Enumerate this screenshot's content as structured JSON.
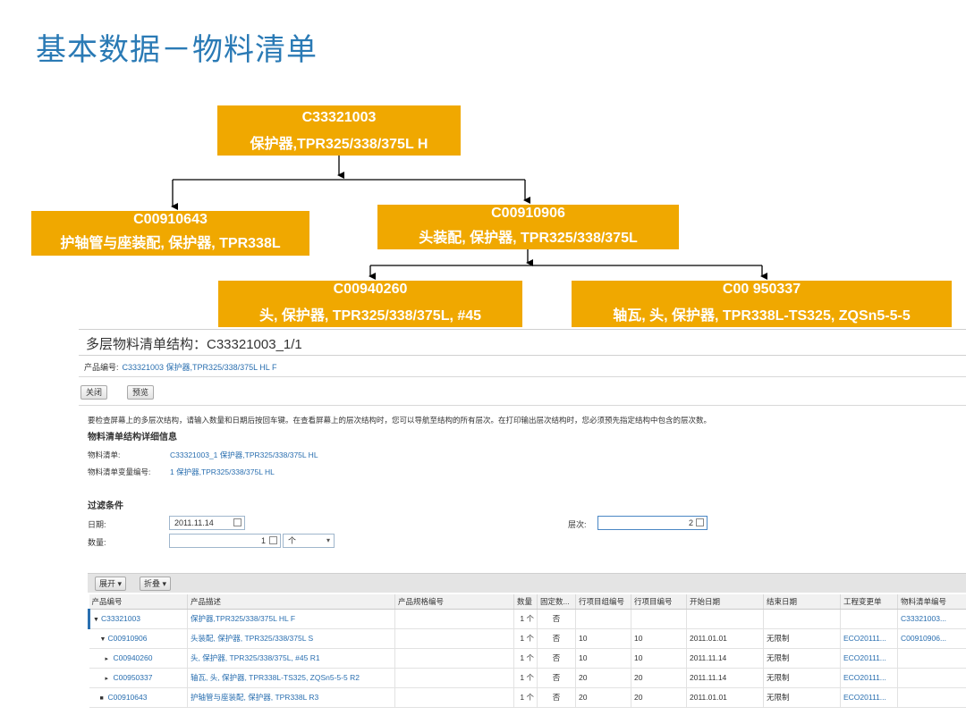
{
  "slide": {
    "title": "基本数据－物料清单"
  },
  "colors": {
    "node_fill": "#f0a800",
    "title_blue": "#2a7ab5",
    "link_blue": "#2a6fb0"
  },
  "tree": {
    "root": {
      "code": "C33321003",
      "desc": "保护器,TPR325/338/375L H"
    },
    "child_a": {
      "code": "C00910643",
      "desc": "护轴管与座装配, 保护器, TPR338L"
    },
    "child_b": {
      "code": "C00910906",
      "desc": "头装配, 保护器, TPR325/338/375L"
    },
    "grand_c": {
      "code": "C00940260",
      "desc": "头, 保护器, TPR325/338/375L, #45"
    },
    "grand_d": {
      "code": "C00 950337",
      "desc": "轴瓦, 头, 保护器, TPR338L-TS325, ZQSn5-5-5"
    }
  },
  "sap": {
    "window_title": "多层物料清单结构：C33321003_1/1",
    "product_label": "产品编号:",
    "product_value": "C33321003 保护器,TPR325/338/375L HL F",
    "close_label": "关闭",
    "preview_label": "预览",
    "instruction": "要检查屏幕上的多层次结构，请输入数量和日期后按回车键。在查看屏幕上的层次结构时，您可以导航至结构的所有层次。在打印输出层次结构时，您必须预先指定结构中包含的层次数。",
    "detail_heading": "物料清单结构详细信息",
    "bom_label": "物料清单:",
    "bom_value": "C33321003_1 保护器,TPR325/338/375L HL",
    "variant_label": "物料清单变量编号:",
    "variant_value": "1 保护器,TPR325/338/375L HL",
    "filter_heading": "过滤条件",
    "date_label": "日期:",
    "date_value": "2011.11.14",
    "qty_label": "数量:",
    "qty_value": "1",
    "unit_value": "个",
    "level_label": "层次:",
    "level_value": "2",
    "expand_label": "展开",
    "collapse_label": "折叠",
    "columns": [
      "产品编号",
      "产品描述",
      "产品规格编号",
      "数量",
      "固定数...",
      "行项目组编号",
      "行项目编号",
      "开始日期",
      "结束日期",
      "工程变更单",
      "物料清单编号"
    ],
    "rows": [
      {
        "tw": "▼",
        "code": "C33321003",
        "desc": "保护器,TPR325/338/375L HL F",
        "spec": "",
        "qty": "1 个",
        "fixed": "否",
        "group": "",
        "item": "",
        "start": "",
        "end": "",
        "eco": "",
        "bom": "C33321003..."
      },
      {
        "tw": "▼",
        "code": "C00910906",
        "desc": "头装配, 保护器, TPR325/338/375L S",
        "spec": "",
        "qty": "1 个",
        "fixed": "否",
        "group": "10",
        "item": "10",
        "start": "2011.01.01",
        "end": "无限制",
        "eco": "ECO20111...",
        "bom": "C00910906..."
      },
      {
        "tw": "▸",
        "code": "C00940260",
        "desc": "头, 保护器, TPR325/338/375L, #45 R1",
        "spec": "",
        "qty": "1 个",
        "fixed": "否",
        "group": "10",
        "item": "10",
        "start": "2011.11.14",
        "end": "无限制",
        "eco": "ECO20111...",
        "bom": ""
      },
      {
        "tw": "▸",
        "code": "C00950337",
        "desc": "轴瓦, 头, 保护器, TPR338L-TS325, ZQSn5-5-5 R2",
        "spec": "",
        "qty": "1 个",
        "fixed": "否",
        "group": "20",
        "item": "20",
        "start": "2011.11.14",
        "end": "无限制",
        "eco": "ECO20111...",
        "bom": ""
      },
      {
        "tw": "■",
        "code": "C00910643",
        "desc": "护轴管与座装配, 保护器, TPR338L R3",
        "spec": "",
        "qty": "1 个",
        "fixed": "否",
        "group": "20",
        "item": "20",
        "start": "2011.01.01",
        "end": "无限制",
        "eco": "ECO20111...",
        "bom": ""
      }
    ]
  }
}
